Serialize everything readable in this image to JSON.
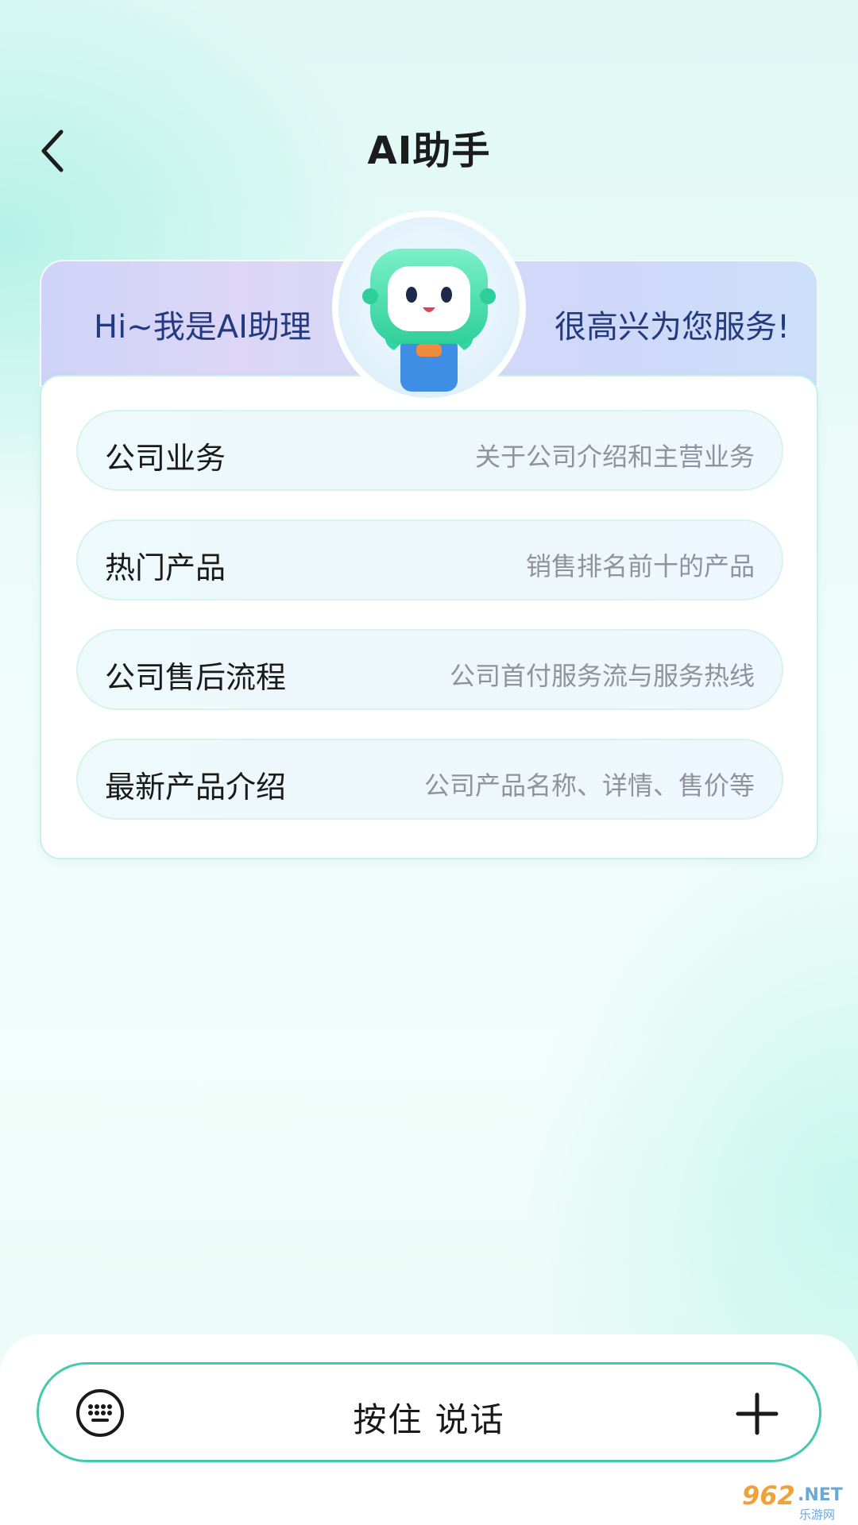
{
  "header": {
    "title": "AI助手",
    "back_icon": "chevron-left-icon"
  },
  "greeting": {
    "left_text": "Hi~我是AI助理",
    "right_text": "很高兴为您服务!",
    "avatar_icon": "robot-mascot-icon"
  },
  "menu": {
    "items": [
      {
        "title": "公司业务",
        "desc": "关于公司介绍和主营业务"
      },
      {
        "title": "热门产品",
        "desc": "销售排名前十的产品"
      },
      {
        "title": "公司售后流程",
        "desc": "公司首付服务流与服务热线"
      },
      {
        "title": "最新产品介绍",
        "desc": "公司产品名称、详情、售价等"
      }
    ]
  },
  "input_bar": {
    "voice_label": "按住 说话",
    "keyboard_icon": "keyboard-icon",
    "plus_icon": "plus-icon"
  },
  "watermark": {
    "brand": "962",
    "net": ".NET",
    "sub": "乐游网"
  },
  "colors": {
    "accent": "#43c9b0",
    "greeting_text": "#223a80",
    "desc_text": "#8f949c"
  }
}
